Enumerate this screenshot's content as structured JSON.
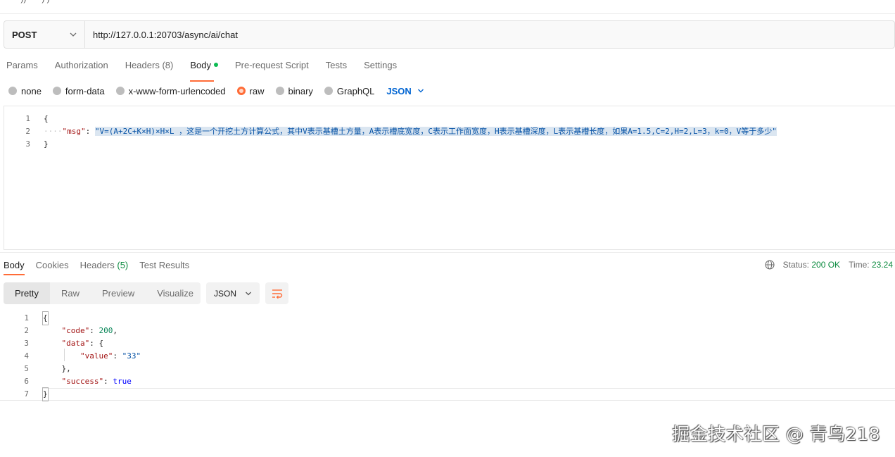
{
  "request": {
    "method": "POST",
    "url": "http://127.0.0.1:20703/async/ai/chat",
    "tabs": [
      {
        "label": "Params"
      },
      {
        "label": "Authorization"
      },
      {
        "label": "Headers",
        "count": "(8)"
      },
      {
        "label": "Body"
      },
      {
        "label": "Pre-request Script"
      },
      {
        "label": "Tests"
      },
      {
        "label": "Settings"
      }
    ],
    "active_tab": "Body",
    "body_types": [
      "none",
      "form-data",
      "x-www-form-urlencoded",
      "raw",
      "binary",
      "GraphQL"
    ],
    "selected_body_type": "raw",
    "language": "JSON",
    "body_lines": {
      "open": "{",
      "key": "\"msg\"",
      "colon": ": ",
      "value": "\"V=(A+2C+K×H)×H×L ，这是一个开挖土方计算公式，其中V表示基槽土方量，A表示槽底宽度，C表示工作面宽度，H表示基槽深度，L表示基槽长度，如果A=1.5,C=2,H=2,L=3，k=0，V等于多少\"",
      "close": "}"
    }
  },
  "response": {
    "tabs": [
      {
        "label": "Body"
      },
      {
        "label": "Cookies"
      },
      {
        "label": "Headers",
        "count": "(5)"
      },
      {
        "label": "Test Results"
      }
    ],
    "status_label": "Status:",
    "status_value": "200 OK",
    "time_label": "Time:",
    "time_value": "23.24",
    "views": [
      "Pretty",
      "Raw",
      "Preview",
      "Visualize"
    ],
    "format": "JSON",
    "lines": {
      "l1": "{",
      "code_key": "\"code\"",
      "code_val": "200",
      "data_key": "\"data\"",
      "data_open": "{",
      "value_key": "\"value\"",
      "value_val": "\"33\"",
      "data_close": "},",
      "success_key": "\"success\"",
      "success_val": "true",
      "l7": "}"
    }
  },
  "line_numbers": [
    "1",
    "2",
    "3",
    "4",
    "5",
    "6",
    "7"
  ],
  "watermark": "掘金技术社区 @ 青鸟218",
  "colors": {
    "accent": "#ff6c37",
    "link": "#0265d2",
    "success": "#0a8a3e"
  }
}
